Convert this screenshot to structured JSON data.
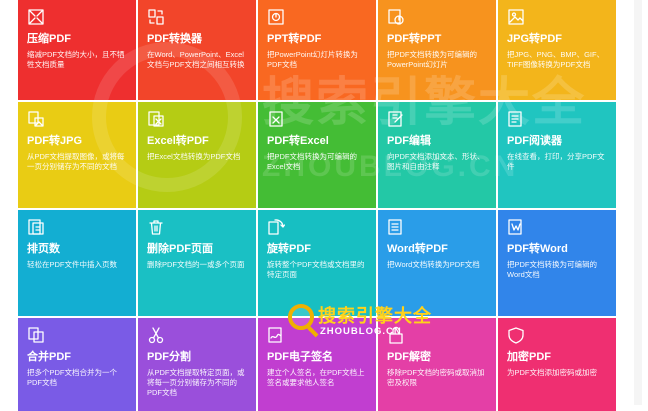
{
  "watermark": {
    "brand": "搜索引擎大全",
    "url": "ZHOUBLOG.CN"
  },
  "tiles": [
    {
      "title": "压缩PDF",
      "desc": "缩减PDF文档的大小，且不牺牲文档质量",
      "color": "#ee2f2f",
      "icon": "compress-icon"
    },
    {
      "title": "PDF转换器",
      "desc": "在Word、PowerPoint、Excel文档与PDF文档之间相互转换",
      "color": "#f2452a",
      "icon": "converter-icon"
    },
    {
      "title": "PPT转PDF",
      "desc": "把PowerPoint幻灯片转换为PDF文档",
      "color": "#f96821",
      "icon": "ppt-to-pdf-icon"
    },
    {
      "title": "PDF转PPT",
      "desc": "把PDF文档转换为可编辑的PowerPoint幻灯片",
      "color": "#f7931e",
      "icon": "pdf-to-ppt-icon"
    },
    {
      "title": "JPG转PDF",
      "desc": "把JPG、PNG、BMP、GIF、TIFF图像转换为PDF文档",
      "color": "#f3b51b",
      "icon": "jpg-to-pdf-icon"
    },
    {
      "title": "PDF转JPG",
      "desc": "从PDF文档提取图像，或将每一页分别储存为不同的文档",
      "color": "#e9cc14",
      "icon": "pdf-to-jpg-icon"
    },
    {
      "title": "Excel转PDF",
      "desc": "把Excel文档转换为PDF文档",
      "color": "#b5cc14",
      "icon": "excel-to-pdf-icon"
    },
    {
      "title": "PDF转Excel",
      "desc": "把PDF文档转换为可编辑的Excel文档",
      "color": "#44bd35",
      "icon": "pdf-to-excel-icon"
    },
    {
      "title": "PDF编辑",
      "desc": "向PDF文档添加文本、形状、图片和自由注释",
      "color": "#23c8a6",
      "icon": "edit-icon"
    },
    {
      "title": "PDF阅读器",
      "desc": "在线查看，打印，分享PDF文件",
      "color": "#20c5c0",
      "icon": "reader-icon"
    },
    {
      "title": "排页数",
      "desc": "轻松在PDF文件中插入页数",
      "color": "#13aed2",
      "icon": "page-number-icon"
    },
    {
      "title": "删除PDF页面",
      "desc": "删除PDF文档的一或多个页面",
      "color": "#1ac0c4",
      "icon": "trash-icon"
    },
    {
      "title": "旋转PDF",
      "desc": "旋转整个PDF文档或文档里的特定页面",
      "color": "#17bfc2",
      "icon": "rotate-icon"
    },
    {
      "title": "Word转PDF",
      "desc": "把Word文档转换为PDF文档",
      "color": "#2a9de8",
      "icon": "word-to-pdf-icon"
    },
    {
      "title": "PDF转Word",
      "desc": "把PDF文档转换为可编辑的Word文档",
      "color": "#3185ea",
      "icon": "pdf-to-word-icon"
    },
    {
      "title": "合并PDF",
      "desc": "把多个PDF文档合并为一个PDF文档",
      "color": "#7a5be6",
      "icon": "merge-icon"
    },
    {
      "title": "PDF分割",
      "desc": "从PDF文档提取特定页面，或将每一页分别储存为不同的PDF文档",
      "color": "#9a4fdb",
      "icon": "scissors-icon"
    },
    {
      "title": "PDF电子签名",
      "desc": "建立个人签名，在PDF文档上签名或要求他人签名",
      "color": "#c13ed0",
      "icon": "sign-icon"
    },
    {
      "title": "PDF解密",
      "desc": "移除PDF文档的密码或取消加密及权限",
      "color": "#e43fa6",
      "icon": "unlock-icon"
    },
    {
      "title": "加密PDF",
      "desc": "为PDF文档添加密码或加密",
      "color": "#ef2f71",
      "icon": "shield-icon"
    }
  ]
}
